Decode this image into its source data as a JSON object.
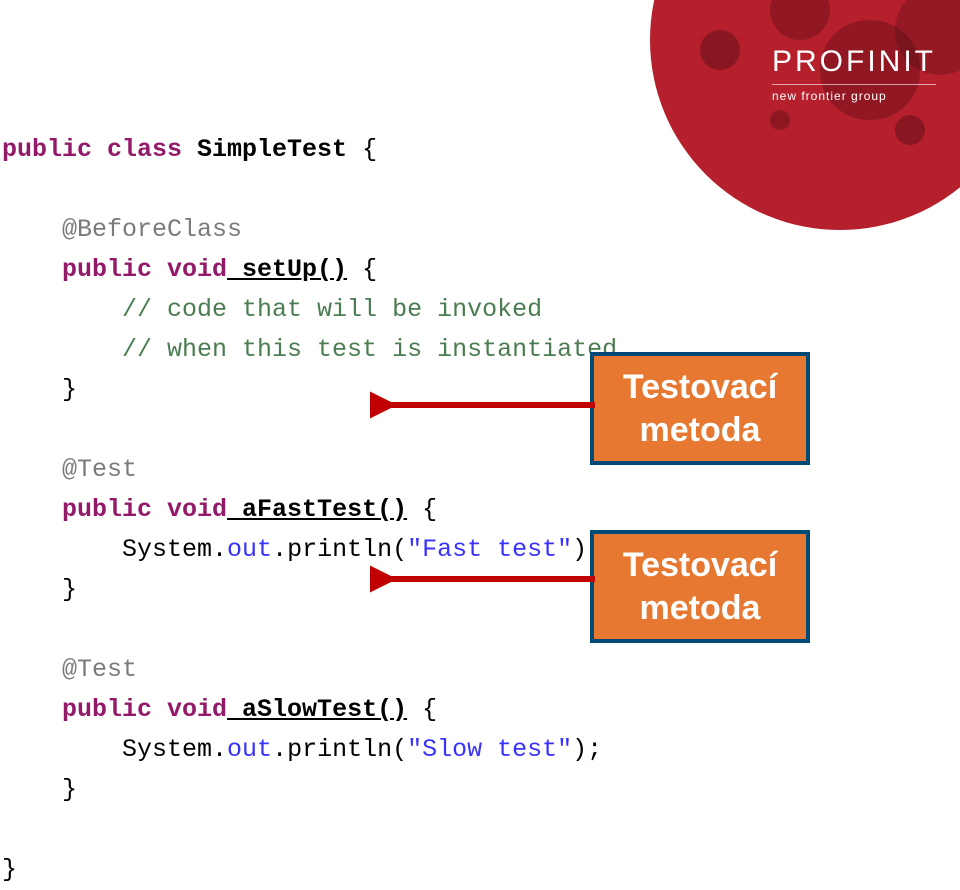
{
  "logo": {
    "main": "PROFINIT",
    "sub": "new frontier group"
  },
  "code": {
    "l1_a": "public",
    "l1_b": " class",
    "l1_c": " SimpleTest",
    "l1_d": " {",
    "l2": "    @BeforeClass",
    "l3_a": "    public",
    "l3_b": " void",
    "l3_c": " setUp()",
    "l3_d": " {",
    "l4": "        // code that will be invoked",
    "l5": "        // when this test is instantiated",
    "l6": "    }",
    "l7": "    @Test",
    "l8_a": "    public",
    "l8_b": " void",
    "l8_c": " aFastTest()",
    "l8_d": " {",
    "l9_a": "        System.",
    "l9_b": "out",
    "l9_c": ".println(",
    "l9_d": "\"Fast test\"",
    "l9_e": ");",
    "l10": "    }",
    "l11": "    @Test",
    "l12_a": "    public",
    "l12_b": " void",
    "l12_c": " aSlowTest()",
    "l12_d": " {",
    "l13_a": "        System.",
    "l13_b": "out",
    "l13_c": ".println(",
    "l13_d": "\"Slow test\"",
    "l13_e": ");",
    "l14": "    }",
    "l15": "}"
  },
  "callouts": {
    "c1_line1": "Testovací",
    "c1_line2": "metoda",
    "c2_line1": "Testovací",
    "c2_line2": "metoda"
  }
}
